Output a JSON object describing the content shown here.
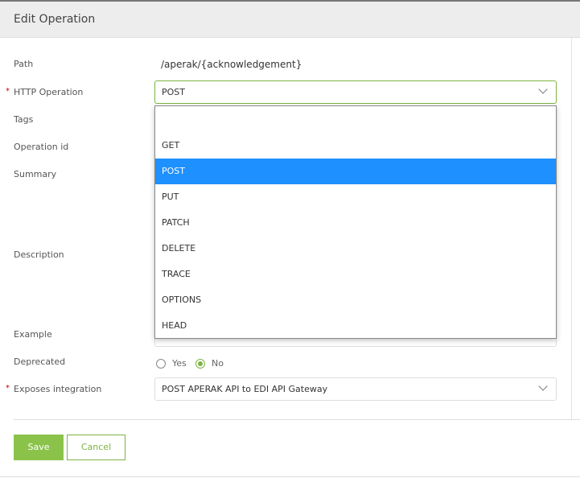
{
  "header": {
    "title": "Edit Operation"
  },
  "form": {
    "path_label": "Path",
    "path_value": "/aperak/{acknowledgement}",
    "http_label": "HTTP Operation",
    "http_value": "POST",
    "tags_label": "Tags",
    "opid_label": "Operation id",
    "summary_label": "Summary",
    "description_label": "Description",
    "example_label": "Example",
    "deprecated_label": "Deprecated",
    "yes_label": "Yes",
    "no_label": "No",
    "deprecated_value": "No",
    "integration_label": "Exposes integration",
    "integration_value": "POST APERAK API to EDI API Gateway",
    "required_mark": "*"
  },
  "dropdown": {
    "options": [
      "",
      "GET",
      "POST",
      "PUT",
      "PATCH",
      "DELETE",
      "TRACE",
      "OPTIONS",
      "HEAD"
    ],
    "selected": "POST"
  },
  "buttons": {
    "save": "Save",
    "cancel": "Cancel"
  },
  "colors": {
    "accent": "#8bc34a",
    "selected": "#1e90ff"
  }
}
